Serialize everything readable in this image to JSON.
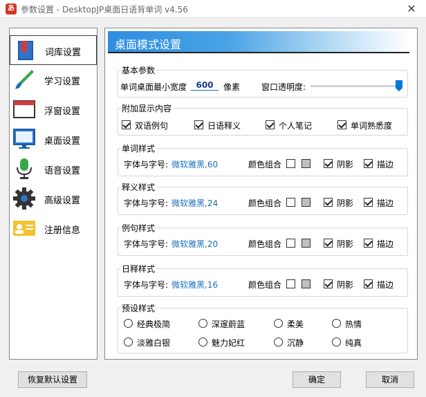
{
  "window": {
    "title": "参数设置 - DesktopJP桌面日语背单词 v4.56",
    "app_icon_text": "あ",
    "close_glyph": "✕"
  },
  "sidebar": {
    "items": [
      {
        "label": "词库设置",
        "icon": "bookmark-book-icon",
        "active": true
      },
      {
        "label": "学习设置",
        "icon": "brush-icon",
        "active": false
      },
      {
        "label": "浮窗设置",
        "icon": "window-icon",
        "active": false
      },
      {
        "label": "桌面设置",
        "icon": "monitor-icon",
        "active": false
      },
      {
        "label": "语音设置",
        "icon": "microphone-icon",
        "active": false
      },
      {
        "label": "高级设置",
        "icon": "gear-icon",
        "active": false
      },
      {
        "label": "注册信息",
        "icon": "id-card-icon",
        "active": false
      }
    ]
  },
  "panel": {
    "title": "桌面模式设置",
    "basic": {
      "title": "基本参数",
      "min_width_label": "单词桌面最小宽度",
      "min_width_value": "600",
      "unit": "像素",
      "opacity_label": "窗口透明度:",
      "opacity_level": 1.0
    },
    "extra": {
      "title": "附加显示内容",
      "options": [
        {
          "label": "双语例句",
          "checked": true
        },
        {
          "label": "日语释义",
          "checked": true
        },
        {
          "label": "个人笔记",
          "checked": true
        },
        {
          "label": "单词熟悉度",
          "checked": true
        }
      ]
    },
    "styles": [
      {
        "title": "单词样式",
        "font_label": "字体与字号:",
        "font_value": "微软雅黑,60",
        "color_label": "颜色组合",
        "shadow_label": "阴影",
        "shadow": true,
        "outline_label": "描边",
        "outline": true,
        "color1": "#ffffff",
        "color2": "#c0c0c0"
      },
      {
        "title": "释义样式",
        "font_label": "字体与字号:",
        "font_value": "微软雅黑,24",
        "color_label": "颜色组合",
        "shadow_label": "阴影",
        "shadow": true,
        "outline_label": "描边",
        "outline": true,
        "color1": "#ffffff",
        "color2": "#c0c0c0"
      },
      {
        "title": "例句样式",
        "font_label": "字体与字号:",
        "font_value": "微软雅黑,20",
        "color_label": "颜色组合",
        "shadow_label": "阴影",
        "shadow": true,
        "outline_label": "描边",
        "outline": true,
        "color1": "#ffffff",
        "color2": "#c0c0c0"
      },
      {
        "title": "日释样式",
        "font_label": "字体与字号:",
        "font_value": "微软雅黑,16",
        "color_label": "颜色组合",
        "shadow_label": "阴影",
        "shadow": true,
        "outline_label": "描边",
        "outline": true,
        "color1": "#ffffff",
        "color2": "#c0c0c0"
      }
    ],
    "presets": {
      "title": "预设样式",
      "options": [
        "经典极简",
        "深邃蔚蓝",
        "柔美",
        "热情",
        "淡雅白银",
        "魅力妃红",
        "沉静",
        "纯真"
      ]
    }
  },
  "buttons": {
    "reset": "恢复默认设置",
    "ok": "确定",
    "cancel": "取消"
  },
  "colors": {
    "accent": "#2e8dde",
    "link": "#1a6fc0",
    "slider_thumb": "#0078d7"
  }
}
